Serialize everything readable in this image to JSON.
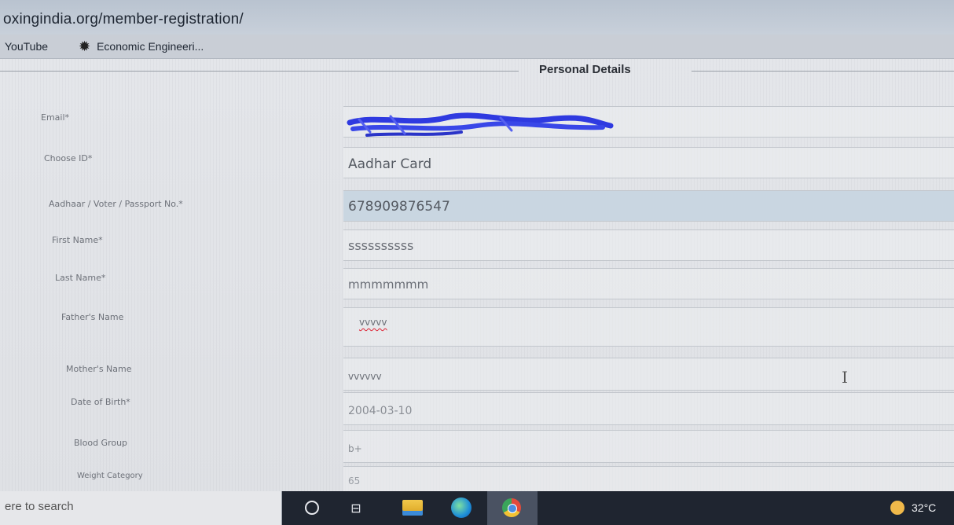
{
  "browser": {
    "url": "oxingindia.org/member-registration/",
    "bookmarks": [
      {
        "label": "YouTube",
        "icon": "youtube-icon"
      },
      {
        "label": "Economic Engineeri...",
        "icon": "starburst-icon"
      }
    ]
  },
  "form": {
    "section_title": "Personal Details",
    "fields": [
      {
        "label": "Email*",
        "value": ""
      },
      {
        "label": "Choose ID*",
        "value": "Aadhar Card"
      },
      {
        "label": "Aadhaar / Voter / Passport No.*",
        "value": "678909876547"
      },
      {
        "label": "First Name*",
        "value": "ssssssssss"
      },
      {
        "label": "Last Name*",
        "value": "mmmmmmm"
      },
      {
        "label": "Father's Name",
        "value": "vvvvv"
      },
      {
        "label": "Mother's Name",
        "value": "vvvvvv"
      },
      {
        "label": "Date of Birth*",
        "value": "2004-03-10"
      },
      {
        "label": "Blood Group",
        "value": "b+"
      },
      {
        "label": "Weight Category",
        "value": "65"
      }
    ]
  },
  "taskbar": {
    "search_placeholder": "ere to search",
    "weather_temp": "32°C"
  },
  "colors": {
    "highlight_field": "#c9d6e1",
    "taskbar": "#1f2530",
    "scribble": "#2f3ae0"
  }
}
